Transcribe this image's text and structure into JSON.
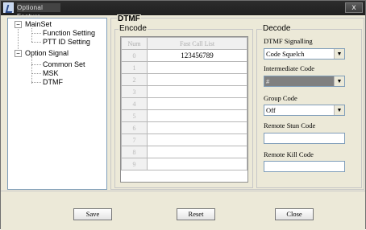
{
  "window": {
    "title": "Optional Feature",
    "close_label": "x"
  },
  "tree": {
    "items": [
      {
        "label": "MainSet"
      },
      {
        "label": "Function Setting"
      },
      {
        "label": "PTT ID Setting"
      },
      {
        "label": "Option Signal"
      },
      {
        "label": "Common Set"
      },
      {
        "label": "MSK"
      },
      {
        "label": "DTMF"
      }
    ]
  },
  "dtmf": {
    "group_title": "DTMF",
    "encode": {
      "title": "Encode",
      "headers": {
        "num": "Num",
        "list": "Fast Call List"
      },
      "rows": [
        {
          "num": "0",
          "value": "123456789"
        },
        {
          "num": "1",
          "value": ""
        },
        {
          "num": "2",
          "value": ""
        },
        {
          "num": "3",
          "value": ""
        },
        {
          "num": "4",
          "value": ""
        },
        {
          "num": "5",
          "value": ""
        },
        {
          "num": "6",
          "value": ""
        },
        {
          "num": "7",
          "value": ""
        },
        {
          "num": "8",
          "value": ""
        },
        {
          "num": "9",
          "value": ""
        }
      ]
    },
    "decode": {
      "title": "Decode",
      "signalling_label": "DTMF Signalling",
      "signalling_value": "Code Squelch",
      "intermediate_label": "Intermediate Code",
      "intermediate_value": "#",
      "group_code_label": "Group Code",
      "group_code_value": "Off",
      "remote_stun_label": "Remote Stun Code",
      "remote_kill_label": "Remote Kill Code"
    }
  },
  "buttons": {
    "save": "Save",
    "reset": "Reset",
    "close": "Close"
  }
}
